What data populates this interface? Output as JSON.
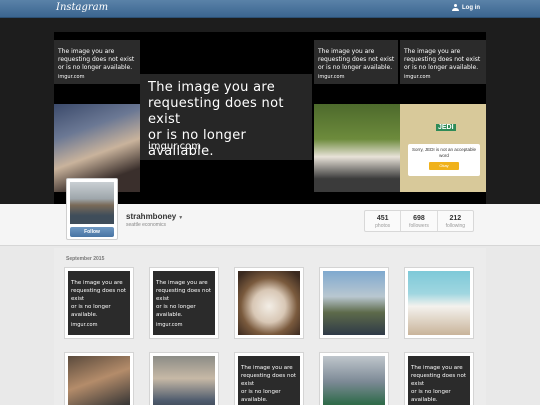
{
  "nav": {
    "logo": "Instagram",
    "login_label": "Log in"
  },
  "missing_image": {
    "message_lines": [
      "The image you are",
      "requesting does not exist",
      "or is no longer available."
    ],
    "source": "imgur.com"
  },
  "cover": {
    "overlay_text": {
      "word": "JEDI",
      "toast": "Sorry, JEDI is not an acceptable word",
      "okay": "Okay"
    }
  },
  "profile": {
    "username": "strahmboney",
    "full_name": "seattle economics",
    "follow_label": "Follow",
    "stats": [
      {
        "value": "451",
        "label": "photos"
      },
      {
        "value": "698",
        "label": "followers"
      },
      {
        "value": "212",
        "label": "following"
      }
    ]
  },
  "feed": {
    "month_label": "September 2015"
  },
  "colors": {
    "nav": "#3b6590",
    "follow": "#4874a3",
    "missing_bg": "#2b2b2b"
  }
}
